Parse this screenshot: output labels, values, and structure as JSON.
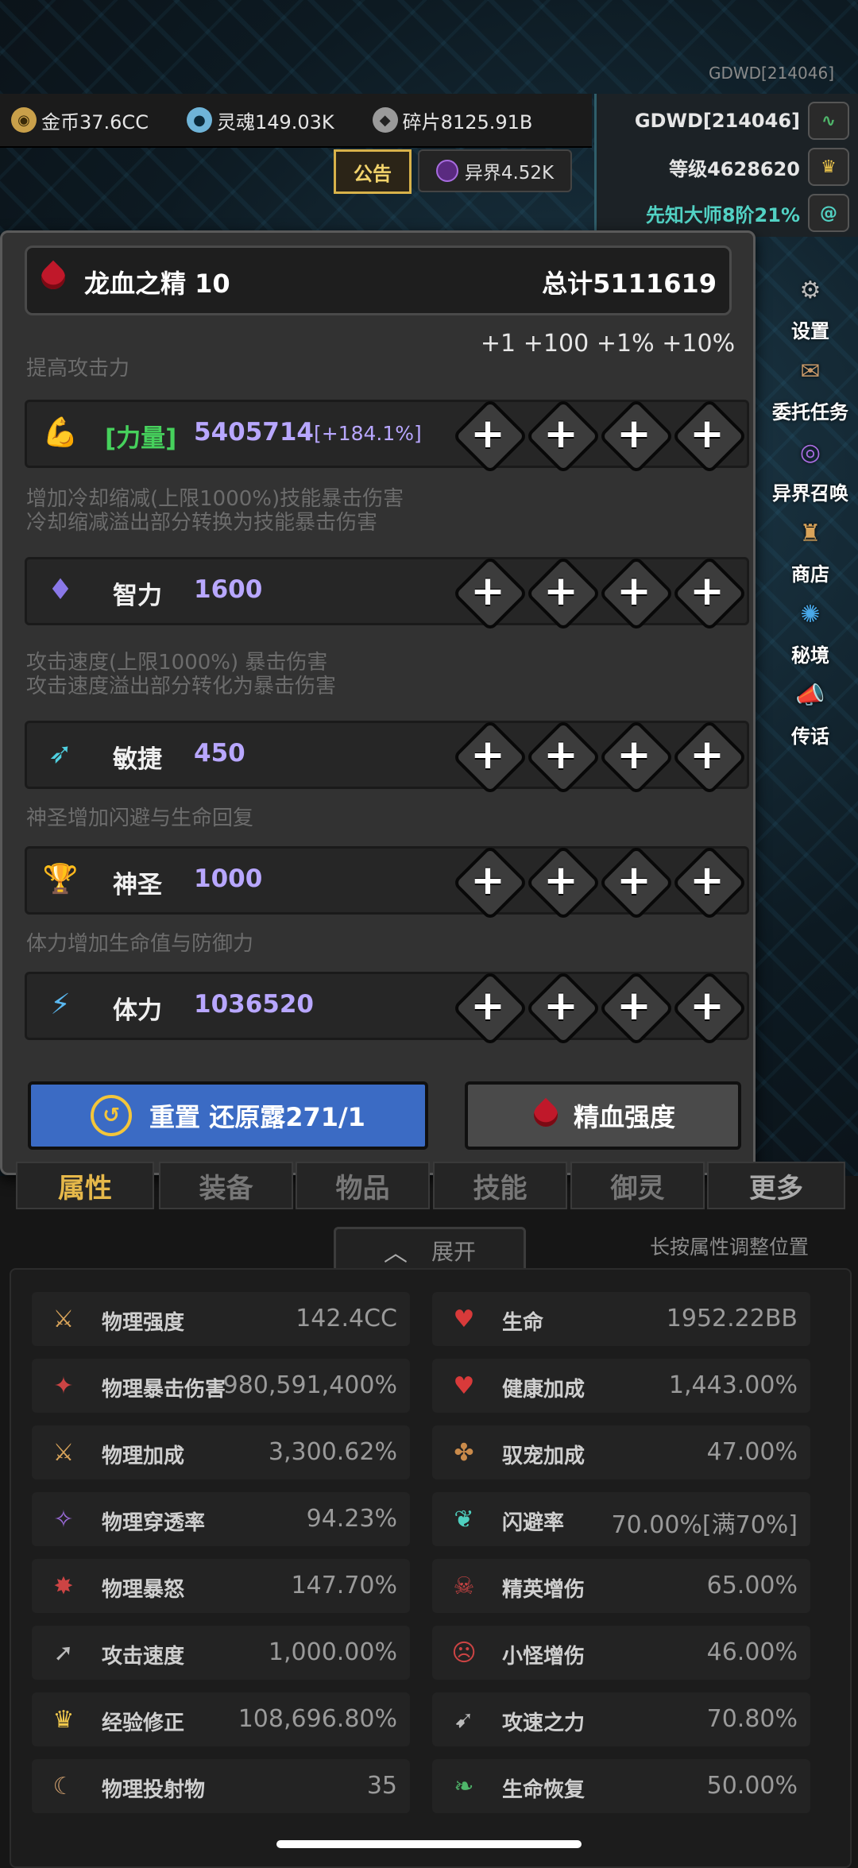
{
  "corner_id": "GDWD[214046]",
  "currency": [
    {
      "icon": "gold-coin-icon",
      "label": "金币37.6CC"
    },
    {
      "icon": "soul-icon",
      "label": "灵魂149.03K"
    },
    {
      "icon": "fragment-icon",
      "label": "碎片8125.91B"
    }
  ],
  "player": {
    "name": "GDWD[214046]",
    "level": "等级4628620",
    "rank": "先知大师8阶21%"
  },
  "notice_tab": "公告",
  "otherworld": "异界4.52K",
  "side_menu": [
    "设置",
    "委托任务",
    "异界召唤",
    "商店",
    "秘境",
    "传话"
  ],
  "modal": {
    "title": "龙血之精 10",
    "total": "总计5111619",
    "increments": [
      "+1",
      "+100",
      "+1%",
      "+10%"
    ],
    "attributes": [
      {
        "desc": [
          "提高攻击力"
        ],
        "name": "[力量]",
        "value": "5405714",
        "extra": "[+184.1%]",
        "icon": "muscle-arm-icon"
      },
      {
        "desc": [
          "增加冷却缩减(上限1000%)技能暴击伤害",
          "冷却缩减溢出部分转换为技能暴击伤害"
        ],
        "name": "智力",
        "value": "1600",
        "extra": "",
        "icon": "planet-crystal-icon"
      },
      {
        "desc": [
          "攻击速度(上限1000%) 暴击伤害",
          "攻击速度溢出部分转化为暴击伤害"
        ],
        "name": "敏捷",
        "value": "450",
        "extra": "",
        "icon": "dash-figure-icon"
      },
      {
        "desc": [
          "神圣增加闪避与生命回复"
        ],
        "name": "神圣",
        "value": "1000",
        "extra": "",
        "icon": "trophy-chalice-icon"
      },
      {
        "desc": [
          "体力增加生命值与防御力"
        ],
        "name": "体力",
        "value": "1036520",
        "extra": "",
        "icon": "lightning-icon"
      }
    ],
    "reset_label": "重置 还原露271/1",
    "essence_label": "精血强度"
  },
  "tabs": [
    "属性",
    "装备",
    "物品",
    "技能",
    "御灵",
    "更多"
  ],
  "expand_label": "展开",
  "hint": "长按属性调整位置",
  "stats_left": [
    {
      "name": "物理强度",
      "value": "142.4CC",
      "icon": "sword-strength-icon"
    },
    {
      "name": "物理暴击伤害",
      "value": "980,591,400%",
      "icon": "crit-blade-icon"
    },
    {
      "name": "物理加成",
      "value": "3,300.62%",
      "icon": "sword-bonus-icon"
    },
    {
      "name": "物理穿透率",
      "value": "94.23%",
      "icon": "penetration-icon"
    },
    {
      "name": "物理暴怒",
      "value": "147.70%",
      "icon": "rage-icon"
    },
    {
      "name": "攻击速度",
      "value": "1,000.00%",
      "icon": "attack-speed-icon"
    },
    {
      "name": "经验修正",
      "value": "108,696.80%",
      "icon": "crown-icon"
    },
    {
      "name": "物理投射物",
      "value": "35",
      "icon": "projectile-icon"
    }
  ],
  "stats_right": [
    {
      "name": "生命",
      "value": "1952.22BB",
      "icon": "heart-icon"
    },
    {
      "name": "健康加成",
      "value": "1,443.00%",
      "icon": "heart-plus-icon"
    },
    {
      "name": "驭宠加成",
      "value": "47.00%",
      "icon": "paw-icon"
    },
    {
      "name": "闪避率",
      "value": "70.00%[满70%]",
      "icon": "dodge-icon"
    },
    {
      "name": "精英增伤",
      "value": "65.00%",
      "icon": "elite-skull-icon"
    },
    {
      "name": "小怪增伤",
      "value": "46.00%",
      "icon": "monster-icon"
    },
    {
      "name": "攻速之力",
      "value": "70.80%",
      "icon": "speed-power-icon"
    },
    {
      "name": "生命恢复",
      "value": "50.00%",
      "icon": "sprout-icon"
    }
  ]
}
